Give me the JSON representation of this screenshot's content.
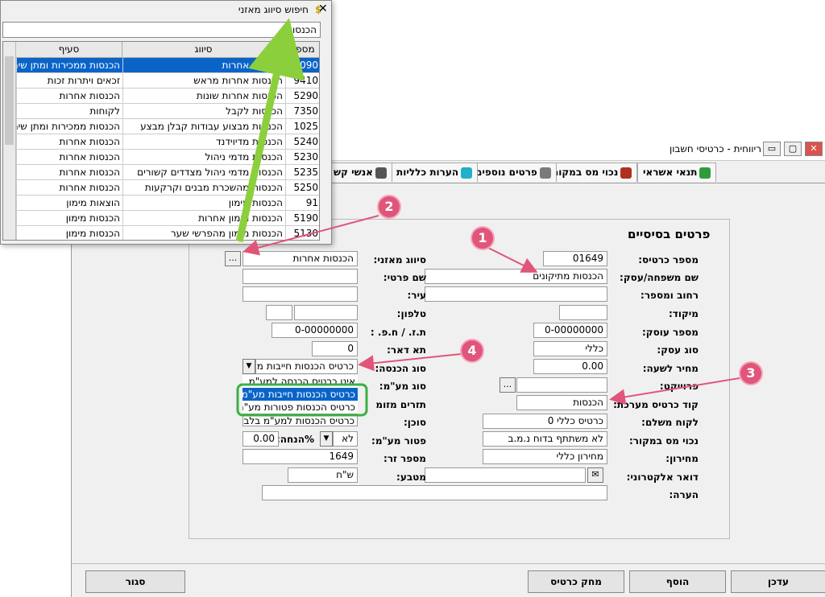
{
  "window": {
    "title": "ריווחית - כרטיסי חשבון",
    "minimize": "▭",
    "maximize": "▢",
    "close": "✕"
  },
  "tabs": [
    {
      "label": "תנאי אשראי",
      "icon": "money-bag-icon",
      "color": "#2e9c3a"
    },
    {
      "label": "נכוי מס במקור",
      "icon": "stamp-icon",
      "color": "#b03020"
    },
    {
      "label": "פרטים נוספים",
      "icon": "hand-icon",
      "color": "#7a7a7a"
    },
    {
      "label": "הערות כלליות",
      "icon": "note-icon",
      "color": "#20b0c8"
    },
    {
      "label": "אנשי קש",
      "icon": "people-icon",
      "color": "#555555"
    }
  ],
  "form": {
    "group_title": "פרטים בסיסיים",
    "card_number_label": "מספר כרטיס:",
    "card_number": "01649",
    "family_name_label": "שם משפחה/עסק:",
    "family_name": "הכנסות מתיקונים",
    "street_label": "רחוב ומספר:",
    "street": "",
    "zip_label": "מיקוד:",
    "zip": "",
    "dealer_label": "מספר עוסק:",
    "dealer": "0-00000000",
    "business_type_label": "סוג עסק:",
    "business_type": "כללי",
    "hourly_price_label": "מחיר לשעה:",
    "hourly_price": "0.00",
    "project_label": "פרוייקט:",
    "project": "",
    "system_code_label": "קוד כרטיס מערכת:",
    "system_code": "הכנסות",
    "general_customer_label": "לקוח משלם:",
    "general_customer": "כרטיס כללי 0",
    "tax_withholding_label": "נכוי מס במקור:",
    "tax_withholding": "לא משתתף בדוח נ.מ.ב",
    "price_list_label": "מחירון:",
    "price_list": "מחירון כללי",
    "email_label": "דואר אלקטרוני:",
    "email": "",
    "notes_label": "הערה:",
    "notes": "",
    "balance_class_label": "סיווג מאזני:",
    "balance_class": "הכנסות אחרות",
    "first_name_label": "שם פרטי:",
    "first_name": "",
    "city_label": "עיר:",
    "city": "",
    "phone_label": "טלפון:",
    "phone": "",
    "id_label": "ת.ז. / ח.פ. :",
    "id_value": "0-00000000",
    "po_box_label": "תא דאר:",
    "po_box": "0",
    "income_type_label": "סוג הכנסה:",
    "income_type": "כרטיס הכנסות חייבות מע",
    "income_options": [
      "אינו כרטיס הכנסה למע\"מ",
      "כרטיס הכנסות חייבות מע\"מ",
      "כרטיס הכנסות פטורות מע\"מ",
      "כרטיס הכנסות למע\"מ בלבד"
    ],
    "vat_type_label": "סוג מע\"מ:",
    "flows_label": "תזרים מזומ",
    "agent_label": "סוכן:",
    "vat_exempt_label": "פטור מע\"מ:",
    "vat_exempt": "לא",
    "discount_label": "%הנחה:",
    "discount": "0.00",
    "foreign_number_label": "מספר זר:",
    "foreign_number": "1649",
    "currency_label": "מטבע:",
    "currency": "ש\"ח"
  },
  "buttons": {
    "update": "עדכן",
    "add": "הוסף",
    "delete": "מחק כרטיס",
    "close": "סגור",
    "ellipsis": "..."
  },
  "popup": {
    "title": "חיפוש סיווג מאזני",
    "close": "✕",
    "search": "הכנסות",
    "columns": [
      "מספר",
      "סיווג",
      "סעיף"
    ],
    "rows": [
      [
        "1090",
        "הכנסות אחרות",
        "הכנסות ממכירות ומתן שיר"
      ],
      [
        "9410",
        "הכנסות אחרות מראש",
        "זכאים ויתרות זכות"
      ],
      [
        "5290",
        "הכנסות אחרות שונות",
        "הכנסות אחרות"
      ],
      [
        "7350",
        "הכנסות לקבל",
        "לקוחות"
      ],
      [
        "1025",
        "הכנסות מבצוע עבודות קבלן מבצע",
        "הכנסות ממכירות ומתן שיר"
      ],
      [
        "5240",
        "הכנסות מדיוידנד",
        "הכנסות אחרות"
      ],
      [
        "5230",
        "הכנסות מדמי ניהול",
        "הכנסות אחרות"
      ],
      [
        "5235",
        "הכנסות מדמי ניהול מצדדים קשורים",
        "הכנסות אחרות"
      ],
      [
        "5250",
        "הכנסות מהשכרת מבנים וקרקעות",
        "הכנסות אחרות"
      ],
      [
        "91",
        "הכנסות מימון",
        "הוצאות מימון"
      ],
      [
        "5190",
        "הכנסות מימון אחרות",
        "הכנסות מימון"
      ],
      [
        "5130",
        "הכנסות מימון מהפרשי שער",
        "הכנסות מימון"
      ]
    ]
  },
  "markers": [
    "1",
    "2",
    "3",
    "4"
  ],
  "colors": {
    "marker": "#e0557a",
    "arrow_green": "#8ccf3c",
    "highlight_green": "#3cb043",
    "selection": "#0a64c8"
  }
}
